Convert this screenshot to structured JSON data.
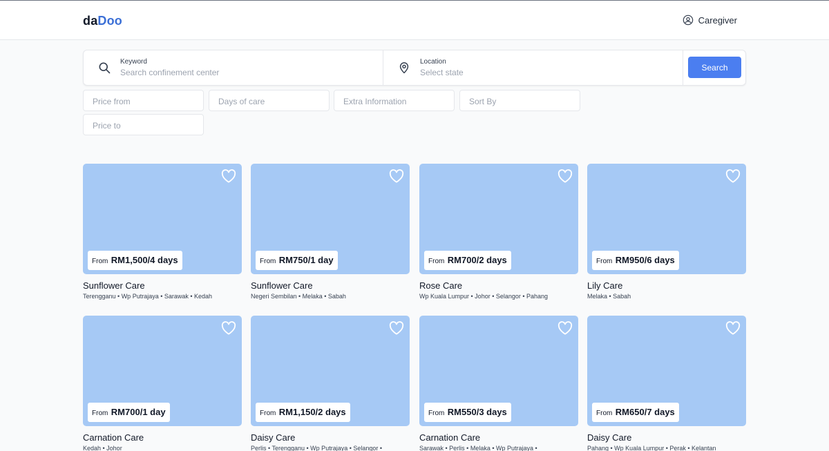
{
  "header": {
    "logo_part1": "da",
    "logo_part2": "Doo",
    "user_label": "Caregiver",
    "user_icon": "user-circle-icon"
  },
  "search": {
    "keyword_label": "Keyword",
    "keyword_placeholder": "Search confinement center",
    "location_label": "Location",
    "location_placeholder": "Select state",
    "button_label": "Search"
  },
  "filters": {
    "price_from": "Price from",
    "days_of_care": "Days of care",
    "extra_information": "Extra Information",
    "sort_by": "Sort By",
    "price_to": "Price to"
  },
  "colors": {
    "accent": "#4b7ef0",
    "card_image_bg": "#a6c9f5",
    "logo_accent": "#3b6fd6"
  },
  "listings": [
    {
      "from": "From",
      "price": "RM1,500/4 days",
      "name": "Sunflower Care",
      "locations": "Terengganu • Wp Putrajaya • Sarawak • Kedah"
    },
    {
      "from": "From",
      "price": "RM750/1 day",
      "name": "Sunflower Care",
      "locations": "Negeri Sembilan • Melaka • Sabah"
    },
    {
      "from": "From",
      "price": "RM700/2 days",
      "name": "Rose Care",
      "locations": "Wp Kuala Lumpur • Johor • Selangor • Pahang"
    },
    {
      "from": "From",
      "price": "RM950/6 days",
      "name": "Lily Care",
      "locations": "Melaka • Sabah"
    },
    {
      "from": "From",
      "price": "RM700/1 day",
      "name": "Carnation Care",
      "locations": "Kedah • Johor"
    },
    {
      "from": "From",
      "price": "RM1,150/2 days",
      "name": "Daisy Care",
      "locations": "Perlis • Terengganu • Wp Putrajaya • Selangor •"
    },
    {
      "from": "From",
      "price": "RM550/3 days",
      "name": "Carnation Care",
      "locations": "Sarawak • Perlis • Melaka • Wp Putrajaya •"
    },
    {
      "from": "From",
      "price": "RM650/7 days",
      "name": "Daisy Care",
      "locations": "Pahang • Wp Kuala Lumpur • Perak • Kelantan"
    }
  ]
}
